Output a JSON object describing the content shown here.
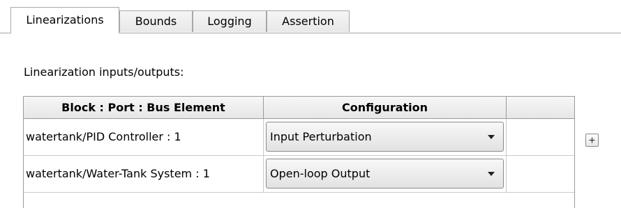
{
  "tabs": [
    {
      "label": "Linearizations",
      "active": true
    },
    {
      "label": "Bounds",
      "active": false
    },
    {
      "label": "Logging",
      "active": false
    },
    {
      "label": "Assertion",
      "active": false
    }
  ],
  "section": {
    "label": "Linearization inputs/outputs:"
  },
  "table": {
    "columns": [
      "Block : Port : Bus Element",
      "Configuration",
      ""
    ],
    "rows": [
      {
        "block_port": "watertank/PID Controller : 1",
        "configuration": "Input Perturbation"
      },
      {
        "block_port": "watertank/Water-Tank System : 1",
        "configuration": "Open-loop Output"
      }
    ]
  },
  "icons": {
    "dropdown": "chevron-down-icon",
    "add": "plus-icon"
  },
  "colors": {
    "border": "#a7a7a7",
    "header_bg": "#eeeeee",
    "background": "#ffffff"
  }
}
